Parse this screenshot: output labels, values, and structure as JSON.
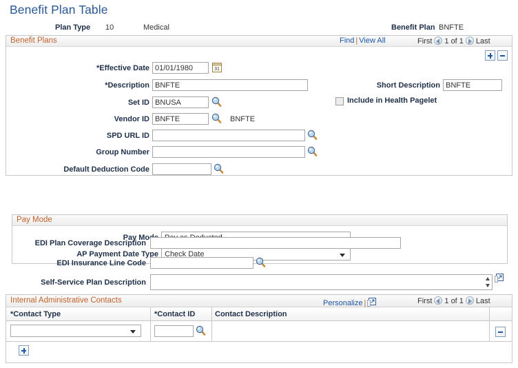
{
  "page": {
    "title": "Benefit Plan Table"
  },
  "summary": {
    "plan_type_label": "Plan Type",
    "plan_type_value": "10",
    "plan_type_desc": "Medical",
    "benefit_plan_label": "Benefit Plan",
    "benefit_plan_value": "BNFTE"
  },
  "benefit_plans": {
    "section_title": "Benefit Plans",
    "find_label": "Find",
    "separator": "|",
    "view_all_label": "View All",
    "first_label": "First",
    "page_indicator": "1 of 1",
    "last_label": "Last",
    "add_row_icon": "plus-icon",
    "delete_row_icon": "minus-icon",
    "fields": {
      "effective_date": {
        "label": "*Effective Date",
        "value": "01/01/1980",
        "icon": "calendar-icon"
      },
      "description": {
        "label": "*Description",
        "value": "BNFTE"
      },
      "short_description": {
        "label": "Short Description",
        "value": "BNFTE"
      },
      "include_health_pagelet": {
        "label": "Include in Health Pagelet",
        "checked": false
      },
      "set_id": {
        "label": "Set ID",
        "value": "BNUSA",
        "icon": "lookup-icon"
      },
      "vendor_id": {
        "label": "Vendor ID",
        "value": "BNFTE",
        "icon": "lookup-icon",
        "description": "BNFTE"
      },
      "spd_url_id": {
        "label": "SPD URL ID",
        "value": "",
        "icon": "lookup-icon"
      },
      "group_number": {
        "label": "Group Number",
        "value": "",
        "icon": "lookup-icon"
      },
      "default_deduction_code": {
        "label": "Default Deduction Code",
        "value": "",
        "icon": "lookup-icon"
      }
    }
  },
  "pay_mode": {
    "section_title": "Pay Mode",
    "pay_mode": {
      "label": "Pay Mode",
      "value": "Pay as Deducted"
    },
    "ap_payment_date_type": {
      "label": "AP Payment Date Type",
      "value": "Check Date"
    }
  },
  "edi": {
    "plan_coverage_description": {
      "label": "EDI Plan Coverage Description",
      "value": ""
    },
    "insurance_line_code": {
      "label": "EDI Insurance Line Code",
      "value": "",
      "icon": "lookup-icon"
    },
    "self_service_plan_description": {
      "label": "Self-Service Plan Description",
      "value": "",
      "expand_icon": "expand-icon"
    }
  },
  "contacts": {
    "section_title": "Internal Administrative Contacts",
    "personalize_label": "Personalize",
    "separator": "|",
    "expand_icon": "expand-icon",
    "first_label": "First",
    "page_indicator": "1 of 1",
    "last_label": "Last",
    "columns": [
      {
        "label": "*Contact Type"
      },
      {
        "label": "*Contact ID"
      },
      {
        "label": "Contact Description"
      }
    ],
    "rows": [
      {
        "contact_type": "",
        "contact_id": "",
        "contact_description": ""
      }
    ],
    "add_row_icon": "plus-icon",
    "delete_row_icon": "minus-icon"
  },
  "colors": {
    "title_blue": "#2b5797",
    "section_orange": "#c1622a",
    "label_navy": "#20304a",
    "link_blue": "#1b55a5",
    "border_gray": "#c6c6c6"
  }
}
